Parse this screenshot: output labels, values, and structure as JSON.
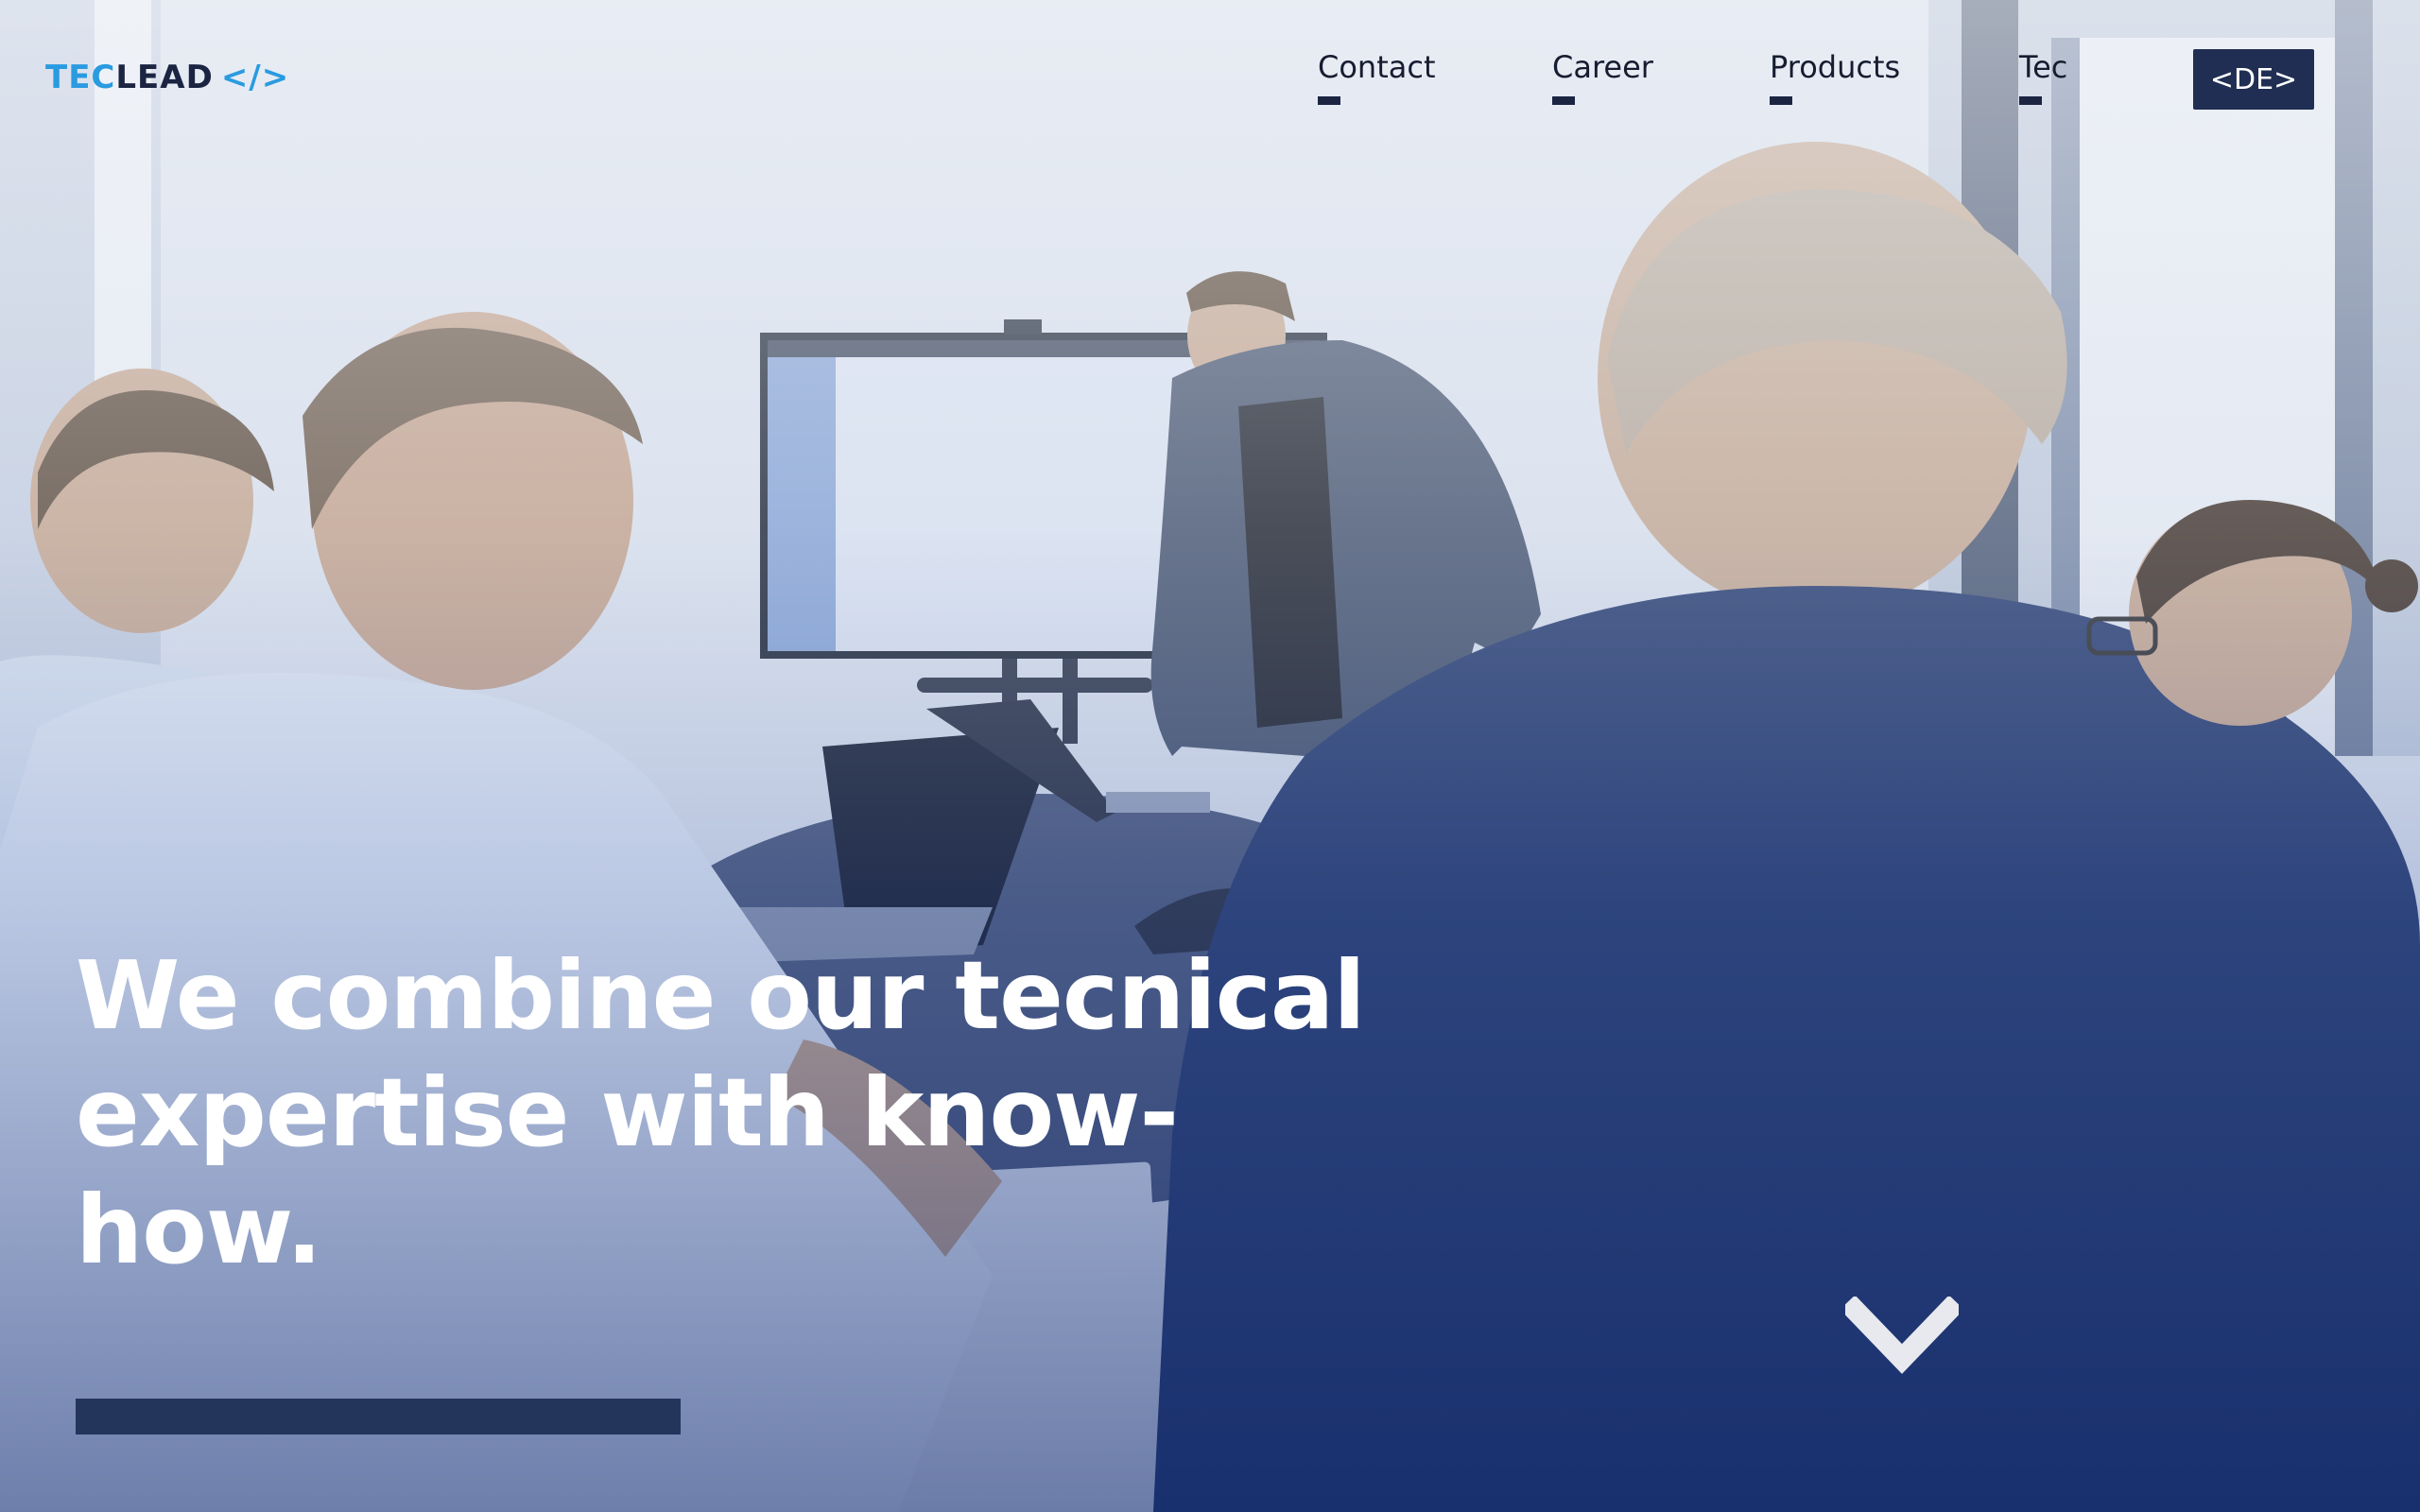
{
  "header": {
    "logo": {
      "part1": "TEC",
      "part2": "LEAD",
      "code": "</>"
    },
    "nav": [
      {
        "label": "Contact"
      },
      {
        "label": "Career"
      },
      {
        "label": "Products"
      },
      {
        "label": "Tec"
      }
    ],
    "language_button": "<DE>"
  },
  "hero": {
    "headline_lines": [
      "We combine our tecnical",
      "expertise with know-",
      "how."
    ],
    "image_subject": "team meeting with presenter at screen",
    "icons": {
      "scroll": "chevron-down-icon"
    }
  },
  "colors": {
    "brand_blue": "#2a9be0",
    "navy": "#1f2e52",
    "overlay_bottom": "#0f2c74"
  }
}
